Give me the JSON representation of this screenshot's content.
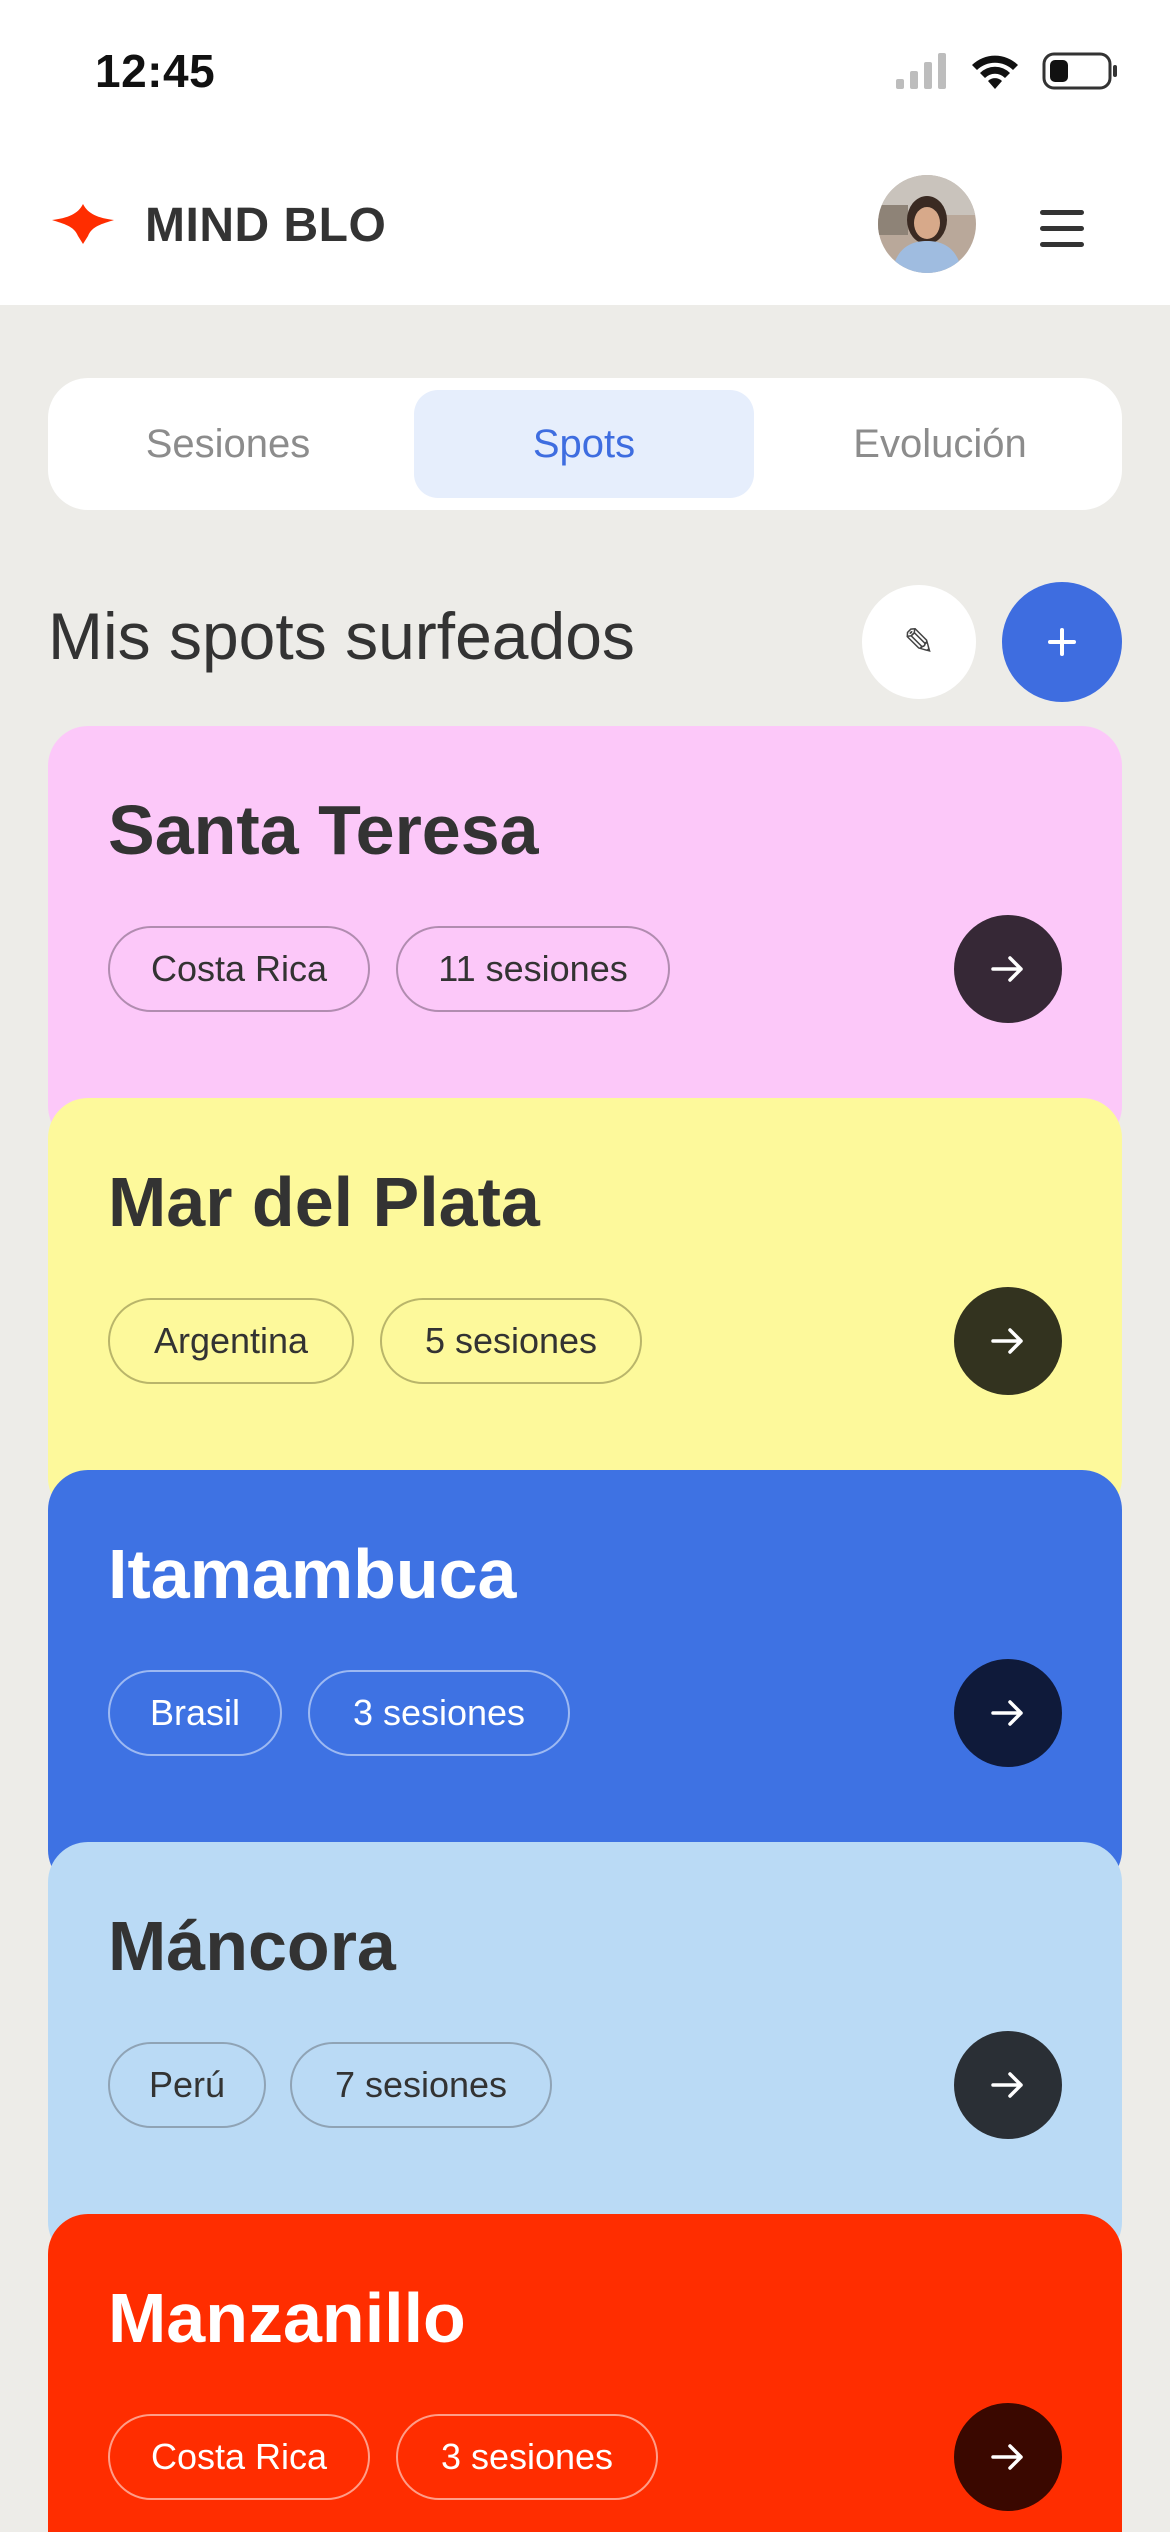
{
  "status_bar": {
    "time": "12:45"
  },
  "header": {
    "brand": "MIND BLO"
  },
  "tabs": [
    {
      "label": "Sesiones"
    },
    {
      "label": "Spots"
    },
    {
      "label": "Evolución"
    }
  ],
  "section": {
    "title": "Mis spots surfeados",
    "edit_icon": "✎",
    "add_icon": "+"
  },
  "spots": [
    {
      "name": "Santa Teresa",
      "country": "Costa Rica",
      "sessions": "11 sesiones",
      "color": "#FCC8F9"
    },
    {
      "name": "Mar del Plata",
      "country": "Argentina",
      "sessions": "5 sesiones",
      "color": "#FDF99B"
    },
    {
      "name": "Itamambuca",
      "country": "Brasil",
      "sessions": "3 sesiones",
      "color": "#3E72E3"
    },
    {
      "name": "Máncora",
      "country": "Perú",
      "sessions": "7 sesiones",
      "color": "#BADAF5"
    },
    {
      "name": "Manzanillo",
      "country": "Costa Rica",
      "sessions": "3 sesiones",
      "color": "#FF2D00"
    }
  ]
}
